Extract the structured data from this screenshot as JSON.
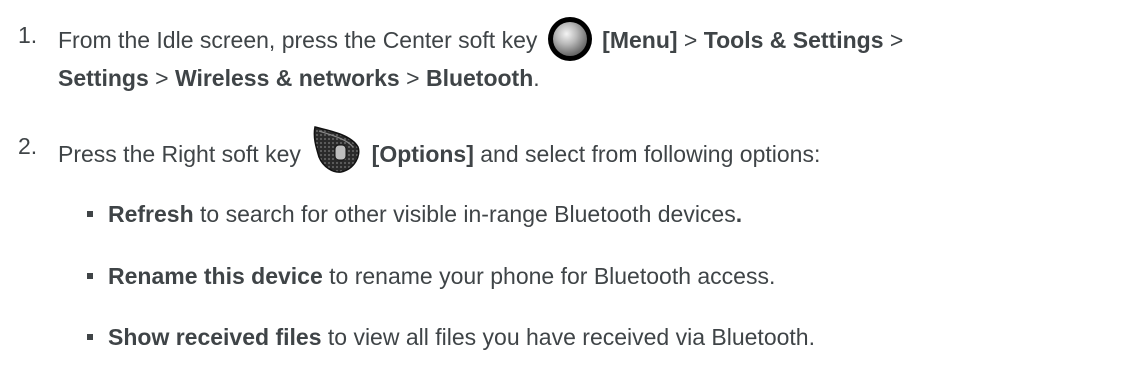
{
  "step1": {
    "number": "1.",
    "line1_prefix": "From the Idle screen, press the Center soft key",
    "menu_label": "[Menu]",
    "sep1": " > ",
    "tools": "Tools & Settings",
    "sep2": " >",
    "settings": "Settings",
    "sep3": " > ",
    "wireless": "Wireless & networks",
    "sep4": " > ",
    "bluetooth": "Bluetooth",
    "end": "."
  },
  "step2": {
    "number": "2.",
    "prefix": "Press the Right soft key",
    "options_label": "[Options]",
    "suffix": " and select from following options:"
  },
  "options": [
    {
      "term": "Refresh",
      "desc": " to search for other visible in-range Bluetooth devices",
      "end": "."
    },
    {
      "term": "Rename this device",
      "desc": " to rename your phone for Bluetooth access.",
      "end": ""
    },
    {
      "term": "Show received files",
      "desc": " to view all files you have received via Bluetooth.",
      "end": ""
    }
  ],
  "icons": {
    "center_key": "center-soft-key-icon",
    "right_key": "right-soft-key-icon"
  }
}
